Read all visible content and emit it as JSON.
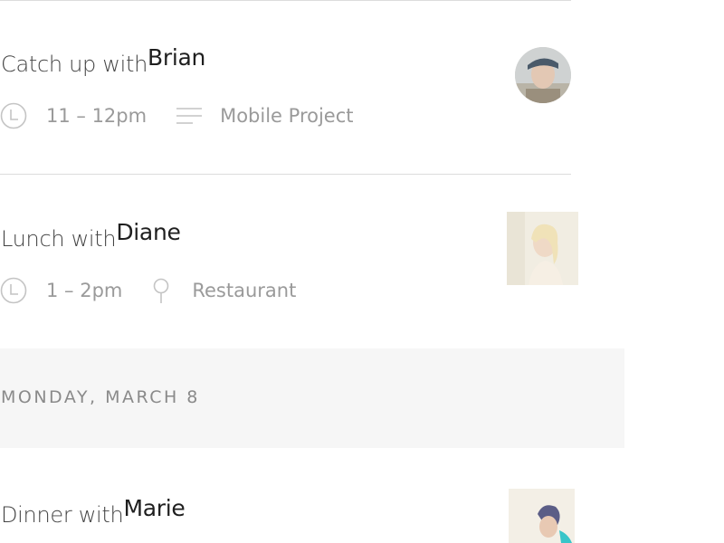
{
  "events": [
    {
      "prefix": "Catch up with",
      "person": "Brian",
      "time": "11 – 12pm",
      "detail": "Mobile Project",
      "detail_icon": "description-icon",
      "avatar_style": "round"
    },
    {
      "prefix": "Lunch with",
      "person": "Diane",
      "time": "1 – 2pm",
      "detail": "Restaurant",
      "detail_icon": "location-pin-icon",
      "avatar_style": "square"
    },
    {
      "prefix": "Dinner with",
      "person": "Marie",
      "avatar_style": "square"
    }
  ],
  "day_header": {
    "label": "MONDAY, MARCH 8"
  },
  "colors": {
    "divider": "#dcdcdc",
    "meta_text": "#9a9a9a",
    "title_text": "#3a3a3a",
    "day_header_bg": "#f6f6f6"
  }
}
